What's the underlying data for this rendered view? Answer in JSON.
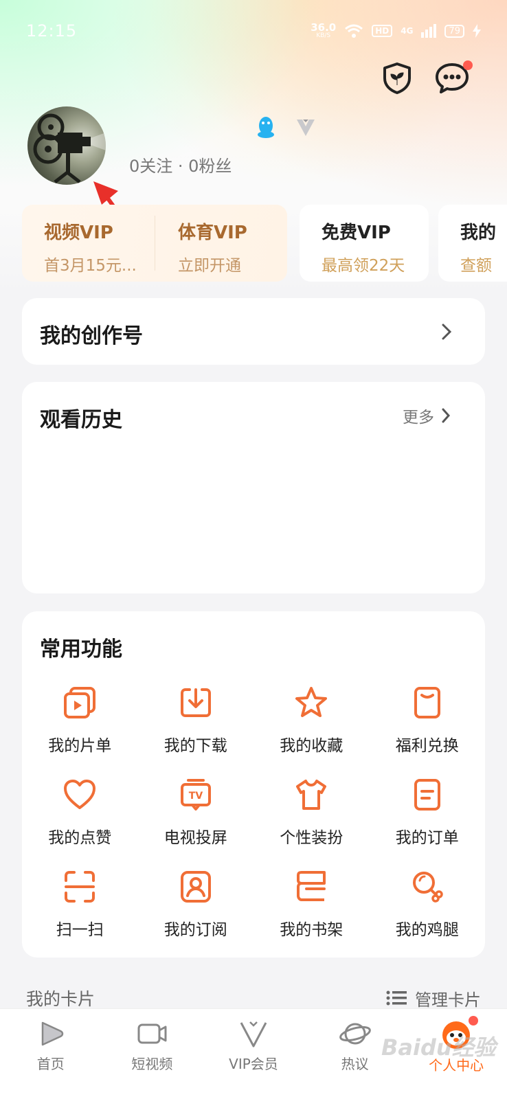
{
  "status_bar": {
    "time": "12:15",
    "net_speed": "36.0",
    "net_unit": "KB/S",
    "hd": "HD",
    "signal": "4G",
    "battery": "79"
  },
  "profile": {
    "stats": "0关注 · 0粉丝"
  },
  "vip_cards": [
    {
      "title": "视频VIP",
      "sub": "首3月15元..."
    },
    {
      "title": "体育VIP",
      "sub": "立即开通"
    },
    {
      "title": "免费VIP",
      "sub": "最高领22天"
    },
    {
      "title": "我的",
      "sub": "查额"
    }
  ],
  "creator": {
    "title": "我的创作号"
  },
  "history": {
    "title": "观看历史",
    "more": "更多"
  },
  "functions": {
    "title": "常用功能",
    "items": [
      {
        "label": "我的片单",
        "icon": "playlist-icon"
      },
      {
        "label": "我的下载",
        "icon": "download-icon"
      },
      {
        "label": "我的收藏",
        "icon": "star-icon"
      },
      {
        "label": "福利兑换",
        "icon": "gift-card-icon"
      },
      {
        "label": "我的点赞",
        "icon": "heart-icon"
      },
      {
        "label": "电视投屏",
        "icon": "tv-cast-icon"
      },
      {
        "label": "个性装扮",
        "icon": "tshirt-icon"
      },
      {
        "label": "我的订单",
        "icon": "order-icon"
      },
      {
        "label": "扫一扫",
        "icon": "scan-icon"
      },
      {
        "label": "我的订阅",
        "icon": "subscribe-icon"
      },
      {
        "label": "我的书架",
        "icon": "bookshelf-icon"
      },
      {
        "label": "我的鸡腿",
        "icon": "drumstick-icon"
      }
    ]
  },
  "my_cards": {
    "title": "我的卡片",
    "manage": "管理卡片"
  },
  "nav": [
    {
      "label": "首页",
      "icon": "home-play-icon"
    },
    {
      "label": "短视频",
      "icon": "short-video-icon"
    },
    {
      "label": "VIP会员",
      "icon": "vip-v-icon"
    },
    {
      "label": "热议",
      "icon": "planet-icon"
    },
    {
      "label": "个人中心",
      "icon": "mascot-icon"
    }
  ],
  "colors": {
    "accent": "#ff6a1a",
    "vip_gold": "#a8692f"
  },
  "watermark": "Baidu经验"
}
